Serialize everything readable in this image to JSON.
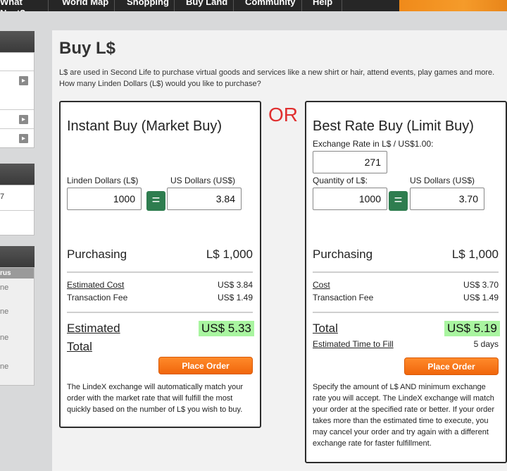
{
  "nav": {
    "items": [
      {
        "label": "What Next?"
      },
      {
        "label": "World Map"
      },
      {
        "label": "Shopping"
      },
      {
        "label": "Buy Land"
      },
      {
        "label": "Community"
      },
      {
        "label": "Help"
      }
    ]
  },
  "sidebar": {
    "row_text_1": "7",
    "section_label": "rus",
    "row_suffix": "ne"
  },
  "page": {
    "title": "Buy L$",
    "intro": "L$ are used in Second Life to purchase virtual goods and services like a new shirt or hair, attend events, play games and more. How many Linden Dollars (L$) would you like to purchase?",
    "or_label": "OR"
  },
  "instant": {
    "title": "Instant Buy (Market Buy)",
    "ld_label": "Linden Dollars (L$)",
    "us_label": "US Dollars (US$)",
    "ld_value": "1000",
    "us_value": "3.84",
    "eq": "=",
    "purchasing_label": "Purchasing",
    "purchasing_value": "L$ 1,000",
    "cost_label": "Estimated Cost",
    "cost_value": "US$ 3.84",
    "fee_label": "Transaction Fee",
    "fee_value": "US$ 1.49",
    "total_label_1": "Estimated",
    "total_label_2": "Total",
    "total_value": "US$ 5.33",
    "button": "Place Order",
    "description": "The LindeX exchange will automatically match your order with the market rate that will fulfill the most quickly based on the number of L$ you wish to buy."
  },
  "limit": {
    "title": "Best Rate Buy (Limit Buy)",
    "rate_label": "Exchange Rate in L$ / US$1.00:",
    "rate_value": "271",
    "qty_label": "Quantity of L$:",
    "us_label": "US Dollars (US$)",
    "qty_value": "1000",
    "us_value": "3.70",
    "eq": "=",
    "purchasing_label": "Purchasing",
    "purchasing_value": "L$ 1,000",
    "cost_label": "Cost",
    "cost_value": "US$ 3.70",
    "fee_label": "Transaction Fee",
    "fee_value": "US$ 1.49",
    "total_label": "Total",
    "total_value": "US$ 5.19",
    "time_label": "Estimated Time to Fill",
    "time_value": "5 days",
    "button": "Place Order",
    "description": "Specify the amount of L$ AND minimum exchange rate you will accept. The LindeX exchange will match your order at the specified rate or better. If your order takes more than the estimated time to execute, you may cancel your order and try again with a different exchange rate for faster fulfillment."
  }
}
